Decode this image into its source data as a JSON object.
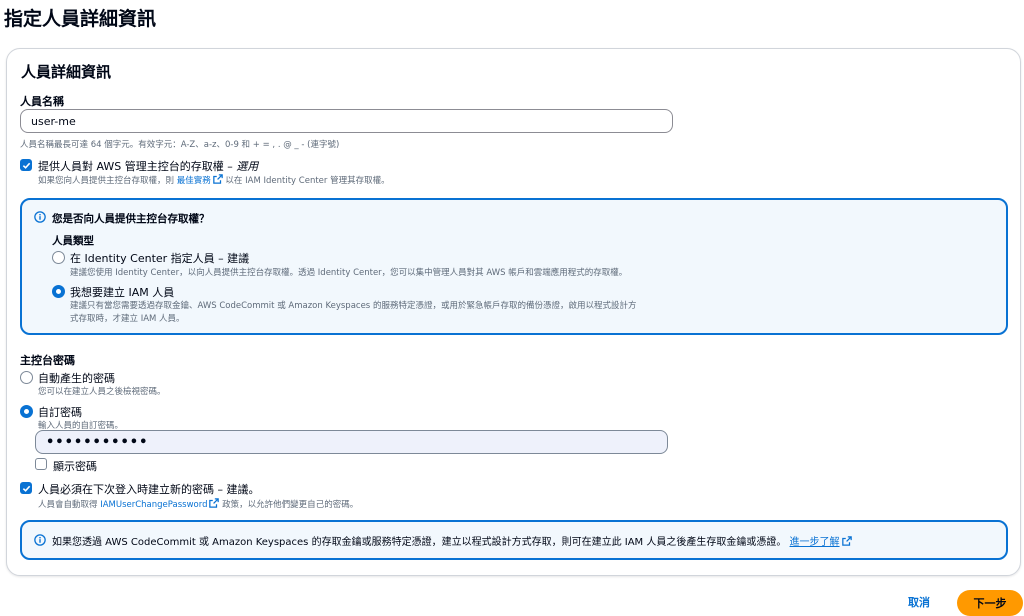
{
  "page": {
    "title": "指定人員詳細資訊"
  },
  "details": {
    "title": "人員詳細資訊",
    "user_name": {
      "label": "人員名稱",
      "value": "user-me",
      "hint": "人員名稱最長可達 64 個字元。有效字元：A-Z、a-z、0-9 和 + = , . @ _ - (連字號)"
    },
    "console_access": {
      "checked": true,
      "label": "提供人員對 AWS 管理主控台的存取權 – ",
      "optional": "選用",
      "desc_before": "如果您向人員提供主控台存取權，則 ",
      "desc_link": "最佳實務",
      "desc_after": " 以在 IAM Identity Center 管理其存取權。"
    },
    "access_question": {
      "title": "您是否向人員提供主控台存取權？",
      "user_type_label": "人員類型",
      "options": [
        {
          "selected": false,
          "label": "在 Identity Center 指定人員 – 建議",
          "desc": "建議您使用 Identity Center，以向人員提供主控台存取權。透過 Identity Center，您可以集中管理人員對其 AWS 帳戶和雲端應用程式的存取權。"
        },
        {
          "selected": true,
          "label": "我想要建立 IAM 人員",
          "desc_line1": "建議只有當您需要透過存取金鑰、AWS CodeCommit 或 Amazon Keyspaces 的服務特定憑證，或用於緊急帳戶存取的備份憑證，啟用以程式設計方",
          "desc_line2": "式存取時，才建立 IAM 人員。"
        }
      ]
    },
    "console_password": {
      "label": "主控台密碼",
      "options": [
        {
          "selected": false,
          "label": "自動產生的密碼",
          "desc": "您可以在建立人員之後檢視密碼。"
        },
        {
          "selected": true,
          "label": "自訂密碼",
          "desc": "輸入人員的自訂密碼。"
        }
      ],
      "password_value": "•••••••••••",
      "show_password": {
        "checked": false,
        "label": "顯示密碼"
      }
    },
    "reset_password": {
      "checked": true,
      "label": "人員必須在下次登入時建立新的密碼 – 建議。",
      "desc_before": "人員會自動取得 ",
      "desc_link": "IAMUserChangePassword",
      "desc_after": " 政策，以允許他們變更自己的密碼。"
    },
    "info_note": {
      "text": "如果您透過 AWS CodeCommit 或 Amazon Keyspaces 的存取金鑰或服務特定憑證，建立以程式設計方式存取，則可在建立此 IAM 人員之後產生存取金鑰或憑證。",
      "link": "進一步了解"
    }
  },
  "footer": {
    "cancel": "取消",
    "next": "下一步"
  },
  "colors": {
    "accent": "#0972d3",
    "primary_button": "#ff9900",
    "info_bg": "#f2f8fd"
  }
}
